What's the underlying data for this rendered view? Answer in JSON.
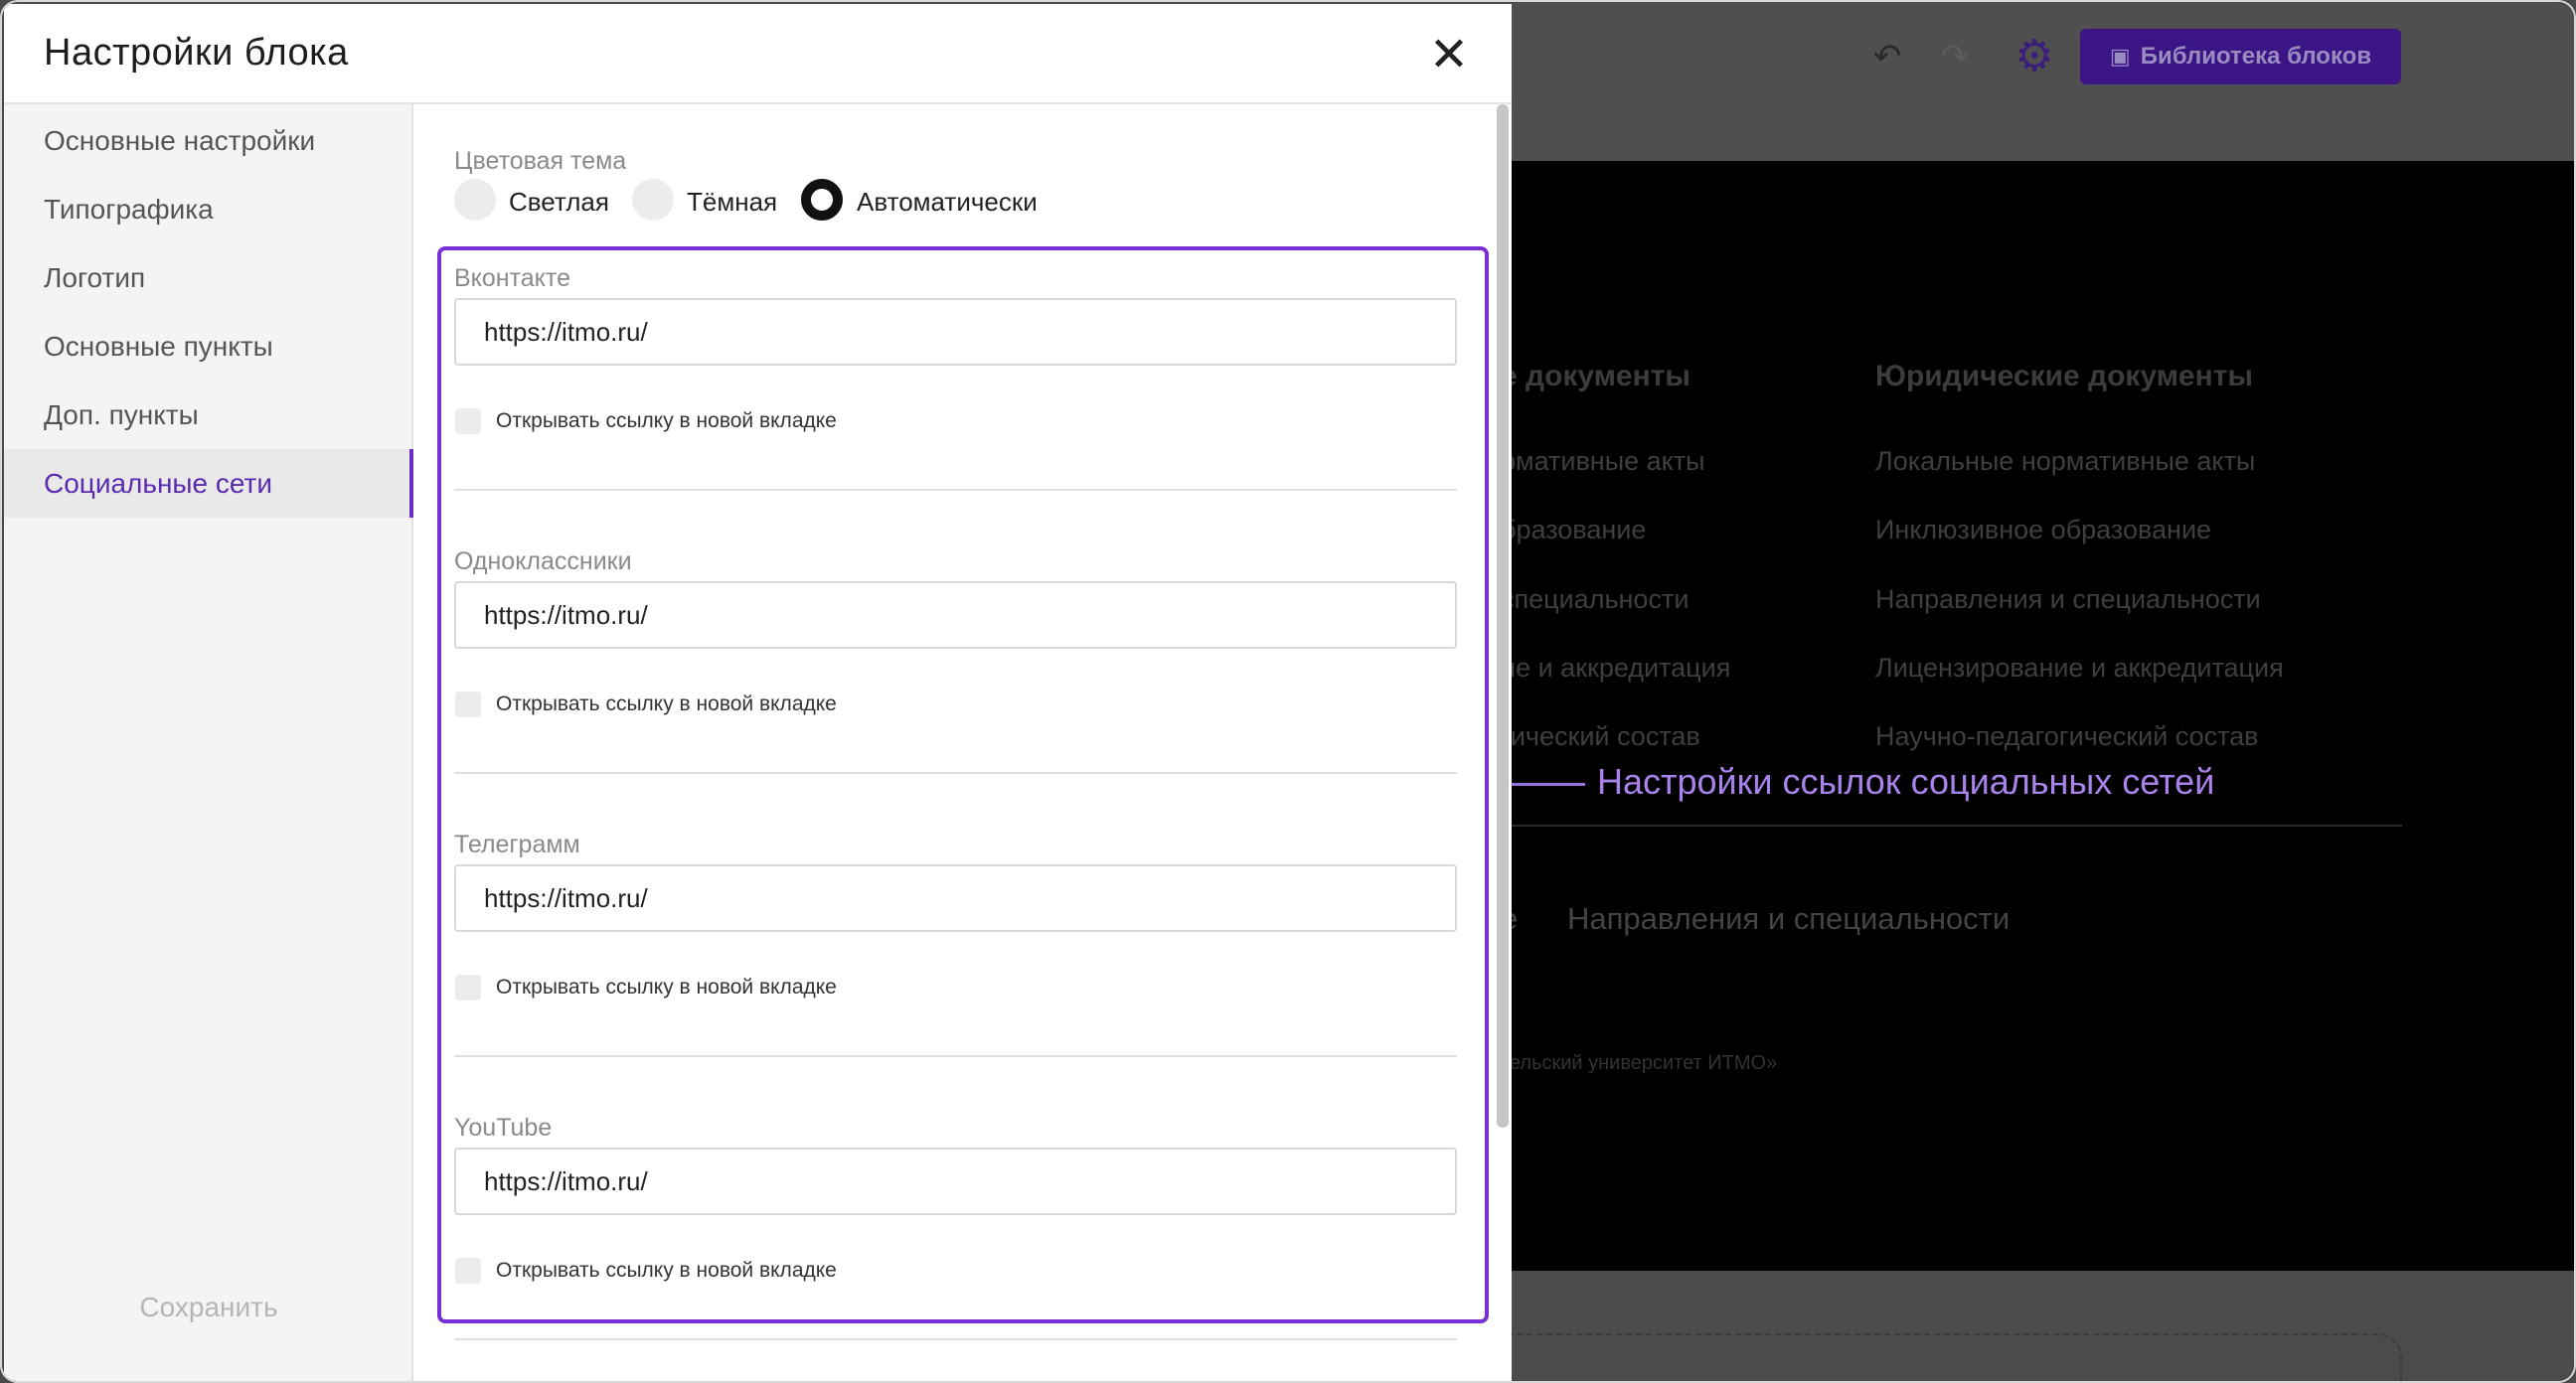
{
  "editor": {
    "undo_icon": "undo-icon",
    "redo_icon": "redo-icon",
    "settings_icon": "gear-icon",
    "library_button": "Библиотека блоков",
    "library_icon": "book-icon"
  },
  "footer_preview": {
    "col1_heading": "е документы",
    "col1_links": [
      "рмативные акты",
      "бразование",
      "специальности",
      "ие и аккредитация",
      "гический состав"
    ],
    "col2_heading": "Юридические документы",
    "col2_links": [
      "Локальные нормативные акты",
      "Инклюзивное образование",
      "Направления и специальности",
      "Лицензирование и аккредитация",
      "Научно-педагогический состав"
    ],
    "bottom_links": [
      "е",
      "Направления и специальности"
    ],
    "copyright": "тельский университет ИТМО»"
  },
  "annotation": {
    "text": "Настройки ссылок социальных сетей",
    "color": "#a982ec"
  },
  "modal": {
    "title": "Настройки блока",
    "close_icon": "close-icon",
    "sidebar": {
      "items": [
        {
          "label": "Основные настройки",
          "active": false
        },
        {
          "label": "Типографика",
          "active": false
        },
        {
          "label": "Логотип",
          "active": false
        },
        {
          "label": "Основные пункты",
          "active": false
        },
        {
          "label": "Доп. пункты",
          "active": false
        },
        {
          "label": "Социальные сети",
          "active": true
        }
      ],
      "save_label": "Сохранить"
    },
    "theme": {
      "label": "Цветовая тема",
      "options": [
        {
          "label": "Светлая",
          "selected": false
        },
        {
          "label": "Тёмная",
          "selected": false
        },
        {
          "label": "Автоматически",
          "selected": true
        }
      ]
    },
    "socials": [
      {
        "name": "Вконтакте",
        "url": "https://itmo.ru/",
        "new_tab_label": "Открывать ссылку в новой вкладке",
        "new_tab": false
      },
      {
        "name": "Одноклассники",
        "url": "https://itmo.ru/",
        "new_tab_label": "Открывать ссылку в новой вкладке",
        "new_tab": false
      },
      {
        "name": "Телеграмм",
        "url": "https://itmo.ru/",
        "new_tab_label": "Открывать ссылку в новой вкладке",
        "new_tab": false
      },
      {
        "name": "YouTube",
        "url": "https://itmo.ru/",
        "new_tab_label": "Открывать ссылку в новой вкладке",
        "new_tab": false
      }
    ],
    "accent_color": "#7a2fd6"
  }
}
